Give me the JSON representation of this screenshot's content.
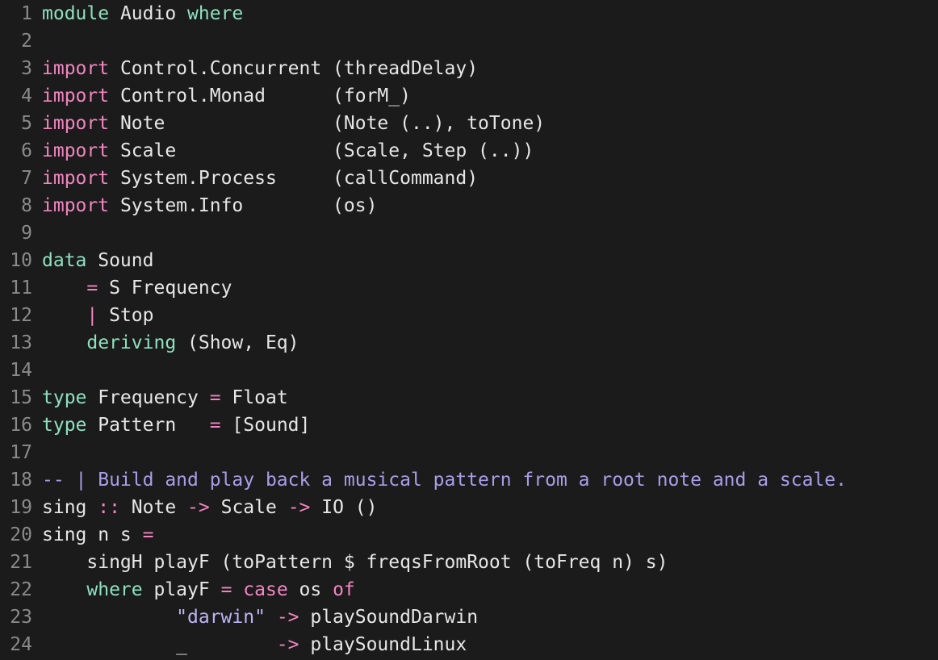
{
  "editor": {
    "colors": {
      "background": "#1b1b1b",
      "line_number": "#8a8a8a",
      "keyword": "#f285c0",
      "type_keyword": "#8ee0c0",
      "comment": "#a89ee8",
      "string": "#bdb4f5",
      "text": "#e6e6e6"
    },
    "lines": [
      {
        "n": "1",
        "tokens": [
          [
            "ty",
            "module"
          ],
          [
            "pl",
            " Audio "
          ],
          [
            "ty",
            "where"
          ]
        ]
      },
      {
        "n": "2",
        "tokens": []
      },
      {
        "n": "3",
        "tokens": [
          [
            "kw",
            "import"
          ],
          [
            "pl",
            " Control.Concurrent (threadDelay)"
          ]
        ]
      },
      {
        "n": "4",
        "tokens": [
          [
            "kw",
            "import"
          ],
          [
            "pl",
            " Control.Monad      (forM_)"
          ]
        ]
      },
      {
        "n": "5",
        "tokens": [
          [
            "kw",
            "import"
          ],
          [
            "pl",
            " Note               (Note (..), toTone)"
          ]
        ]
      },
      {
        "n": "6",
        "tokens": [
          [
            "kw",
            "import"
          ],
          [
            "pl",
            " Scale              (Scale, Step (..))"
          ]
        ]
      },
      {
        "n": "7",
        "tokens": [
          [
            "kw",
            "import"
          ],
          [
            "pl",
            " System.Process     (callCommand)"
          ]
        ]
      },
      {
        "n": "8",
        "tokens": [
          [
            "kw",
            "import"
          ],
          [
            "pl",
            " System.Info        (os)"
          ]
        ]
      },
      {
        "n": "9",
        "tokens": []
      },
      {
        "n": "10",
        "tokens": [
          [
            "ty",
            "data"
          ],
          [
            "pl",
            " Sound"
          ]
        ]
      },
      {
        "n": "11",
        "tokens": [
          [
            "pl",
            "    "
          ],
          [
            "op",
            "="
          ],
          [
            "pl",
            " S Frequency"
          ]
        ]
      },
      {
        "n": "12",
        "tokens": [
          [
            "pl",
            "    "
          ],
          [
            "op",
            "|"
          ],
          [
            "pl",
            " Stop"
          ]
        ]
      },
      {
        "n": "13",
        "tokens": [
          [
            "pl",
            "    "
          ],
          [
            "ty",
            "deriving"
          ],
          [
            "pl",
            " (Show, Eq)"
          ]
        ]
      },
      {
        "n": "14",
        "tokens": []
      },
      {
        "n": "15",
        "tokens": [
          [
            "ty",
            "type"
          ],
          [
            "pl",
            " Frequency "
          ],
          [
            "op",
            "="
          ],
          [
            "pl",
            " Float"
          ]
        ]
      },
      {
        "n": "16",
        "tokens": [
          [
            "ty",
            "type"
          ],
          [
            "pl",
            " Pattern   "
          ],
          [
            "op",
            "="
          ],
          [
            "pl",
            " [Sound]"
          ]
        ]
      },
      {
        "n": "17",
        "tokens": []
      },
      {
        "n": "18",
        "tokens": [
          [
            "cm",
            "-- | Build and play back a musical pattern from a root note and a scale."
          ]
        ]
      },
      {
        "n": "19",
        "tokens": [
          [
            "pl",
            "sing "
          ],
          [
            "op",
            "::"
          ],
          [
            "pl",
            " Note "
          ],
          [
            "op",
            "->"
          ],
          [
            "pl",
            " Scale "
          ],
          [
            "op",
            "->"
          ],
          [
            "pl",
            " IO ()"
          ]
        ]
      },
      {
        "n": "20",
        "tokens": [
          [
            "pl",
            "sing n s "
          ],
          [
            "op",
            "="
          ]
        ]
      },
      {
        "n": "21",
        "tokens": [
          [
            "pl",
            "    singH playF (toPattern $ freqsFromRoot (toFreq n) s)"
          ]
        ]
      },
      {
        "n": "22",
        "tokens": [
          [
            "pl",
            "    "
          ],
          [
            "ty",
            "where"
          ],
          [
            "pl",
            " playF "
          ],
          [
            "op",
            "="
          ],
          [
            "pl",
            " "
          ],
          [
            "kw",
            "case"
          ],
          [
            "pl",
            " os "
          ],
          [
            "kw",
            "of"
          ]
        ]
      },
      {
        "n": "23",
        "tokens": [
          [
            "pl",
            "            "
          ],
          [
            "st",
            "\"darwin\""
          ],
          [
            "pl",
            " "
          ],
          [
            "op",
            "->"
          ],
          [
            "pl",
            " playSoundDarwin"
          ]
        ]
      },
      {
        "n": "24",
        "tokens": [
          [
            "pl",
            "            _        "
          ],
          [
            "op",
            "->"
          ],
          [
            "pl",
            " playSoundLinux"
          ]
        ]
      }
    ]
  }
}
